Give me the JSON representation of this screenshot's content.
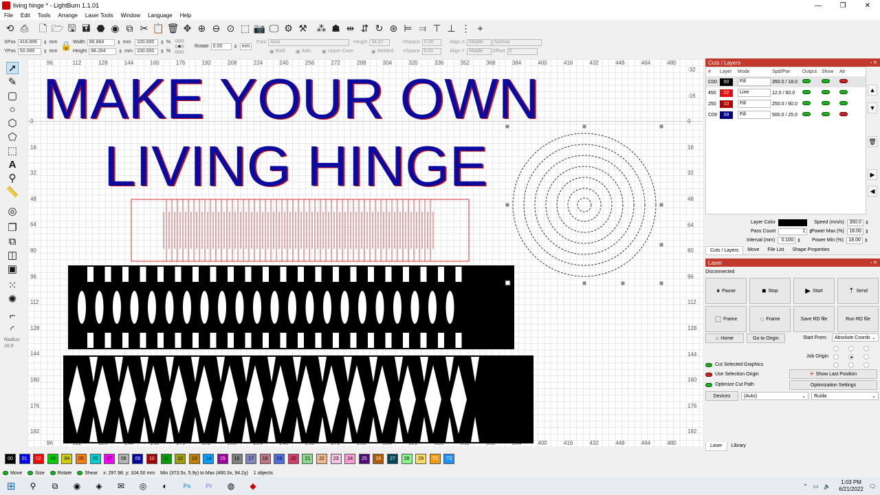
{
  "window": {
    "title": "living hinge * - LightBurn 1.1.01",
    "controls": [
      "—",
      "❐",
      "✕"
    ]
  },
  "menu": [
    "File",
    "Edit",
    "Tools",
    "Arrange",
    "Laser Tools",
    "Window",
    "Language",
    "Help"
  ],
  "toolbar_icons": [
    "undo-redo-icon",
    "print-icon",
    "new-file-icon",
    "open-folder-icon",
    "save-icon",
    "save-as-icon",
    "cut-icon",
    "copy-icon",
    "paste-icon",
    "delete-icon",
    "move-icon",
    "zoom-in-icon",
    "zoom-out-icon",
    "zoom-fit-icon",
    "zoom-frame-icon",
    "camera-icon",
    "monitor-icon",
    "settings-icon",
    "tools-icon",
    "group-icon",
    "ungroup-icon",
    "mirror-h-icon",
    "mirror-v-icon",
    "rotate-icon",
    "align-left-icon",
    "align-right-icon",
    "align-top-icon",
    "align-bottom-icon",
    "distribute-icon",
    "dock-icon"
  ],
  "props": {
    "xpos_label": "XPos",
    "xpos": "416.896",
    "ypos_label": "YPos",
    "ypos": "50.089",
    "unit": "mm",
    "width_label": "Width",
    "width": "86.884",
    "height_label": "Height",
    "height": "88.284",
    "w_percent": "100.000",
    "h_percent": "100.000",
    "pct": "%",
    "rotate_label": "Rotate",
    "rotate": "0.00",
    "rotate_unit": "mm",
    "font_label": "Font",
    "font": "Arial",
    "text_height_label": "Height",
    "text_height": "34.97",
    "hspace_label": "HSpace",
    "hspace": "0.00",
    "vspace_label": "VSpace",
    "vspace": "0.00",
    "alignx_label": "Align X",
    "alignx": "Middle",
    "aligny_label": "Align Y",
    "aligny": "Middle",
    "normal": "Normal",
    "offset_label": "Offset",
    "offset": "0",
    "bold": "Bold",
    "italic": "Italic",
    "uppercase": "Upper Case",
    "welded": "Welded"
  },
  "left_tools": [
    "select-arrow-icon",
    "pen-icon",
    "rectangle-icon",
    "ellipse-icon",
    "polygon-icon",
    "shape-icon",
    "text-icon",
    "position-marker-icon",
    "measure-icon",
    "offset-icon",
    "boolean-union-icon",
    "boolean-diff-icon",
    "boolean-intersect-icon",
    "weld-icon",
    "array-icon",
    "radial-array-icon",
    "corner-icon",
    "fillet-icon"
  ],
  "radius": {
    "label": "Radius:",
    "value": "10.0"
  },
  "rulers": {
    "top": [
      "96",
      "112",
      "128",
      "144",
      "160",
      "176",
      "192",
      "208",
      "224",
      "240",
      "256",
      "272",
      "288",
      "304",
      "320",
      "336",
      "352",
      "368",
      "384",
      "400",
      "416",
      "432",
      "448",
      "464",
      "480"
    ],
    "side": [
      "0",
      "16",
      "32",
      "48",
      "64",
      "80",
      "96",
      "112",
      "128",
      "144",
      "160",
      "176",
      "192"
    ],
    "right": [
      "-32",
      "-16",
      "0",
      "16",
      "32",
      "48",
      "64",
      "80",
      "96",
      "112",
      "128",
      "144",
      "160",
      "176",
      "192"
    ]
  },
  "canvas": {
    "line1": "MAKE YOUR OWN",
    "line2": "LIVING HINGE"
  },
  "cuts": {
    "title": "Cuts / Layers",
    "headers": [
      "#",
      "Layer",
      "Mode",
      "Spd/Pwr",
      "Output",
      "Show",
      "Air"
    ],
    "rows": [
      {
        "num": "C00",
        "layer": "00",
        "color": "#000000",
        "mode": "Fill",
        "spd": "350.0 / 18.0",
        "air": false
      },
      {
        "num": "450",
        "layer": "02",
        "color": "#e01010",
        "mode": "Line",
        "spd": "12.0 / 60.0",
        "air": true
      },
      {
        "num": "250",
        "layer": "10",
        "color": "#b00000",
        "mode": "Fill",
        "spd": "250.0 / 60.0",
        "air": true
      },
      {
        "num": "C09",
        "layer": "09",
        "color": "#000080",
        "mode": "Fill",
        "spd": "500.0 / 25.0",
        "air": false
      }
    ]
  },
  "layer_props": {
    "color_label": "Layer Color",
    "speed_label": "Speed (mm/s)",
    "speed": "350.0",
    "pass_label": "Pass Count",
    "pass": "1",
    "pmax_label": "Power Max (%)",
    "pmax": "18.00",
    "interval_label": "Interval (mm)",
    "interval": "0.100",
    "pmin_label": "Power Min (%)",
    "pmin": "18.00"
  },
  "tabs1": [
    "Cuts / Layers",
    "Move",
    "File List",
    "Shape Properties"
  ],
  "laser": {
    "title": "Laser",
    "status": "Disconnected",
    "buttons": [
      "Pause",
      "Stop",
      "Start",
      "Send",
      "Frame",
      "Frame",
      "Save RD file",
      "Run RD file"
    ],
    "home": "Home",
    "go_origin": "Go to Origin",
    "start_from_label": "Start From:",
    "start_from": "Absolute Coords",
    "job_origin": "Job Origin",
    "cut_selected": "Cut Selected Graphics",
    "use_sel_origin": "Use Selection Origin",
    "optimize": "Optimize Cut Path",
    "show_last": "Show Last Position",
    "opt_settings": "Optimization Settings",
    "devices": "Devices",
    "device_auto": "(Auto)",
    "controller": "Ruida"
  },
  "tabs2": [
    "Laser",
    "Library"
  ],
  "palette": [
    {
      "label": "00",
      "color": "#000000",
      "fg": "#fff"
    },
    {
      "label": "01",
      "color": "#0000ff",
      "fg": "#fff"
    },
    {
      "label": "02",
      "color": "#ff0000",
      "fg": "#fff"
    },
    {
      "label": "03",
      "color": "#00d000",
      "fg": "#000"
    },
    {
      "label": "04",
      "color": "#d0d000",
      "fg": "#000"
    },
    {
      "label": "05",
      "color": "#ff8000",
      "fg": "#000"
    },
    {
      "label": "06",
      "color": "#00d0d0",
      "fg": "#000"
    },
    {
      "label": "07",
      "color": "#ff00ff",
      "fg": "#000"
    },
    {
      "label": "08",
      "color": "#b4b4b4",
      "fg": "#000"
    },
    {
      "label": "09",
      "color": "#0000a0",
      "fg": "#fff"
    },
    {
      "label": "10",
      "color": "#a00000",
      "fg": "#fff"
    },
    {
      "label": "11",
      "color": "#00a000",
      "fg": "#000"
    },
    {
      "label": "12",
      "color": "#a0a000",
      "fg": "#000"
    },
    {
      "label": "13",
      "color": "#c08000",
      "fg": "#000"
    },
    {
      "label": "14",
      "color": "#00a0ff",
      "fg": "#000"
    },
    {
      "label": "15",
      "color": "#a000a0",
      "fg": "#fff"
    },
    {
      "label": "16",
      "color": "#808080",
      "fg": "#000"
    },
    {
      "label": "17",
      "color": "#7d87b9",
      "fg": "#000"
    },
    {
      "label": "18",
      "color": "#bb7784",
      "fg": "#000"
    },
    {
      "label": "19",
      "color": "#4a6fe3",
      "fg": "#000"
    },
    {
      "label": "20",
      "color": "#d33f6a",
      "fg": "#000"
    },
    {
      "label": "21",
      "color": "#8cd78c",
      "fg": "#000"
    },
    {
      "label": "22",
      "color": "#f0b98d",
      "fg": "#000"
    },
    {
      "label": "23",
      "color": "#f6c4e1",
      "fg": "#000"
    },
    {
      "label": "24",
      "color": "#fa9ed4",
      "fg": "#000"
    },
    {
      "label": "25",
      "color": "#500a78",
      "fg": "#fff"
    },
    {
      "label": "26",
      "color": "#b45a00",
      "fg": "#fff"
    },
    {
      "label": "27",
      "color": "#004754",
      "fg": "#fff"
    },
    {
      "label": "28",
      "color": "#86fa88",
      "fg": "#000"
    },
    {
      "label": "29",
      "color": "#ffdb66",
      "fg": "#000"
    },
    {
      "label": "T1",
      "color": "#f39c12",
      "fg": "#fff"
    },
    {
      "label": "T2",
      "color": "#1e90ff",
      "fg": "#fff"
    }
  ],
  "status": {
    "move": "Move",
    "size": "Size",
    "rotate": "Rotate",
    "shear": "Shear",
    "coords": "x: 297.98, y: 104.50 mm",
    "minmax": "Min (373.5x, 5.9y) to Max (460.3x, 94.2y)",
    "objects": "1 objects"
  },
  "taskbar": {
    "time": "1:03 PM",
    "date": "6/21/2022"
  },
  "colors": {
    "text_blue": "#0a0aa0",
    "text_red_outline": "#c81010",
    "hinge_red": "#d03030",
    "panel_red": "#c0392b"
  }
}
